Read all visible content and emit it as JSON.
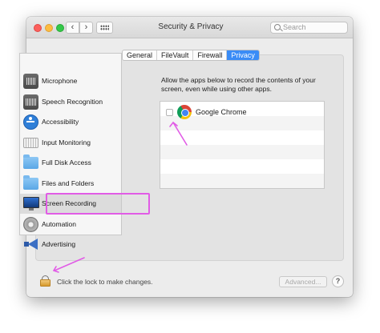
{
  "window": {
    "title": "Security & Privacy"
  },
  "toolbar": {
    "back": "‹",
    "forward": "›"
  },
  "search": {
    "placeholder": "Search"
  },
  "tabs": [
    {
      "label": "General",
      "active": false
    },
    {
      "label": "FileVault",
      "active": false
    },
    {
      "label": "Firewall",
      "active": false
    },
    {
      "label": "Privacy",
      "active": true
    }
  ],
  "sidebar": {
    "items": [
      {
        "label": "Microphone",
        "icon": "microphone-icon"
      },
      {
        "label": "Speech Recognition",
        "icon": "speech-recognition-icon"
      },
      {
        "label": "Accessibility",
        "icon": "accessibility-icon"
      },
      {
        "label": "Input Monitoring",
        "icon": "keyboard-icon"
      },
      {
        "label": "Full Disk Access",
        "icon": "folder-icon"
      },
      {
        "label": "Files and Folders",
        "icon": "folder-icon"
      },
      {
        "label": "Screen Recording",
        "icon": "monitor-icon",
        "selected": true
      },
      {
        "label": "Automation",
        "icon": "gear-icon"
      },
      {
        "label": "Advertising",
        "icon": "megaphone-icon"
      }
    ]
  },
  "main": {
    "description": "Allow the apps below to record the contents of your screen, even while using other apps.",
    "apps": [
      {
        "name": "Google Chrome",
        "checked": false,
        "icon": "chrome-icon"
      }
    ]
  },
  "footer": {
    "lock_label": "Click the lock to make changes.",
    "advanced_label": "Advanced...",
    "help_label": "?"
  },
  "colors": {
    "accent": "#3a8cf6",
    "annotation": "#e15ce6"
  }
}
